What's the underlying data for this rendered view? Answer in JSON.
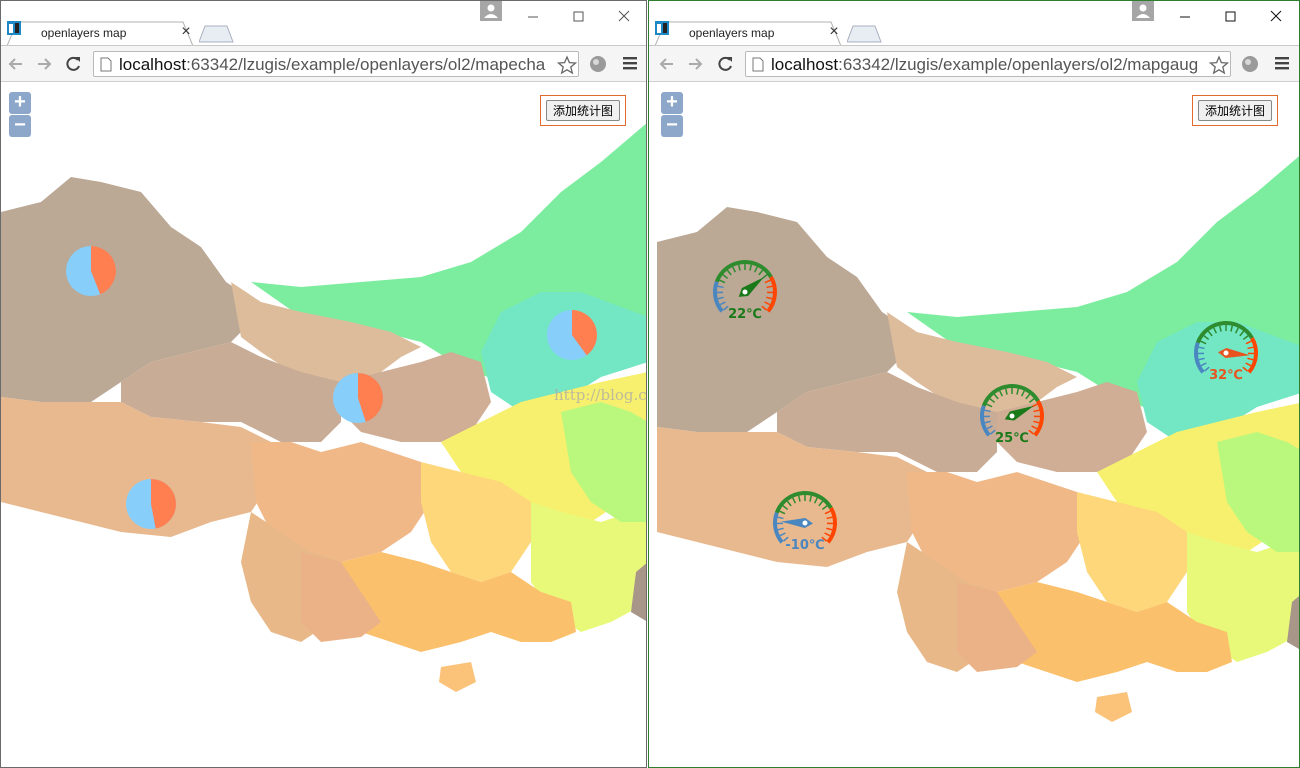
{
  "left": {
    "tab_title": "openlayers map",
    "url_host": "localhost",
    "url_rest": ":63342/lzugis/example/openlayers/ol2/mapecha",
    "add_button": "添加统计图",
    "watermark": "http://blog.csdn.net/",
    "pies": [
      {
        "name": "pie-1",
        "orange": 0.44,
        "blue": 0.56
      },
      {
        "name": "pie-2",
        "orange": 0.4,
        "blue": 0.6
      },
      {
        "name": "pie-3",
        "orange": 0.45,
        "blue": 0.55
      },
      {
        "name": "pie-4",
        "orange": 0.47,
        "blue": 0.53
      }
    ]
  },
  "right": {
    "tab_title": "openlayers map",
    "url_host": "localhost",
    "url_rest": ":63342/lzugis/example/openlayers/ol2/mapgaug",
    "add_button": "添加统计图",
    "gauges": [
      {
        "label": "22℃",
        "color": "#1a7a1a",
        "value": 22
      },
      {
        "label": "25℃",
        "color": "#1a7a1a",
        "value": 25
      },
      {
        "label": "32℃",
        "color": "#e8531f",
        "value": 32
      },
      {
        "label": "-10℃",
        "color": "#4a86c0",
        "value": -10
      }
    ]
  },
  "colors": {
    "pie_orange": "#ff7f50",
    "pie_blue": "#87cefa",
    "zoom": "#6b8fbf",
    "highlight_border": "#e26a2c"
  },
  "icons": [
    "favicon-icon",
    "close-icon",
    "new-tab-icon",
    "profile-icon",
    "minimize-icon",
    "maximize-icon",
    "window-close-icon",
    "back-icon",
    "forward-icon",
    "reload-icon",
    "page-icon",
    "star-icon",
    "extension-icon",
    "menu-icon"
  ]
}
